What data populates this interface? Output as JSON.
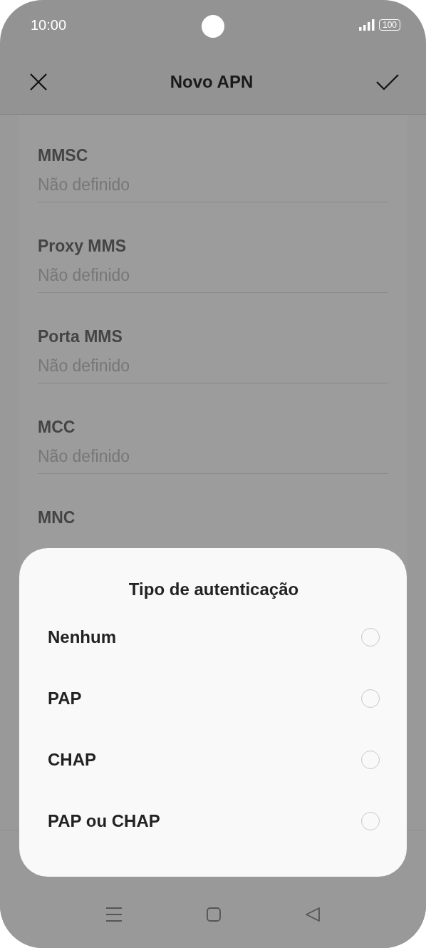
{
  "status_bar": {
    "time": "10:00",
    "battery": "100"
  },
  "header": {
    "title": "Novo APN"
  },
  "fields": [
    {
      "label": "MMSC",
      "value": "Não definido"
    },
    {
      "label": "Proxy MMS",
      "value": "Não definido"
    },
    {
      "label": "Porta MMS",
      "value": "Não definido"
    },
    {
      "label": "MCC",
      "value": "Não definido"
    },
    {
      "label": "MNC"
    }
  ],
  "dialog": {
    "title": "Tipo de autenticação",
    "options": [
      {
        "label": "Nenhum",
        "selected": false
      },
      {
        "label": "PAP",
        "selected": false
      },
      {
        "label": "CHAP",
        "selected": false
      },
      {
        "label": "PAP ou CHAP",
        "selected": false
      }
    ]
  }
}
